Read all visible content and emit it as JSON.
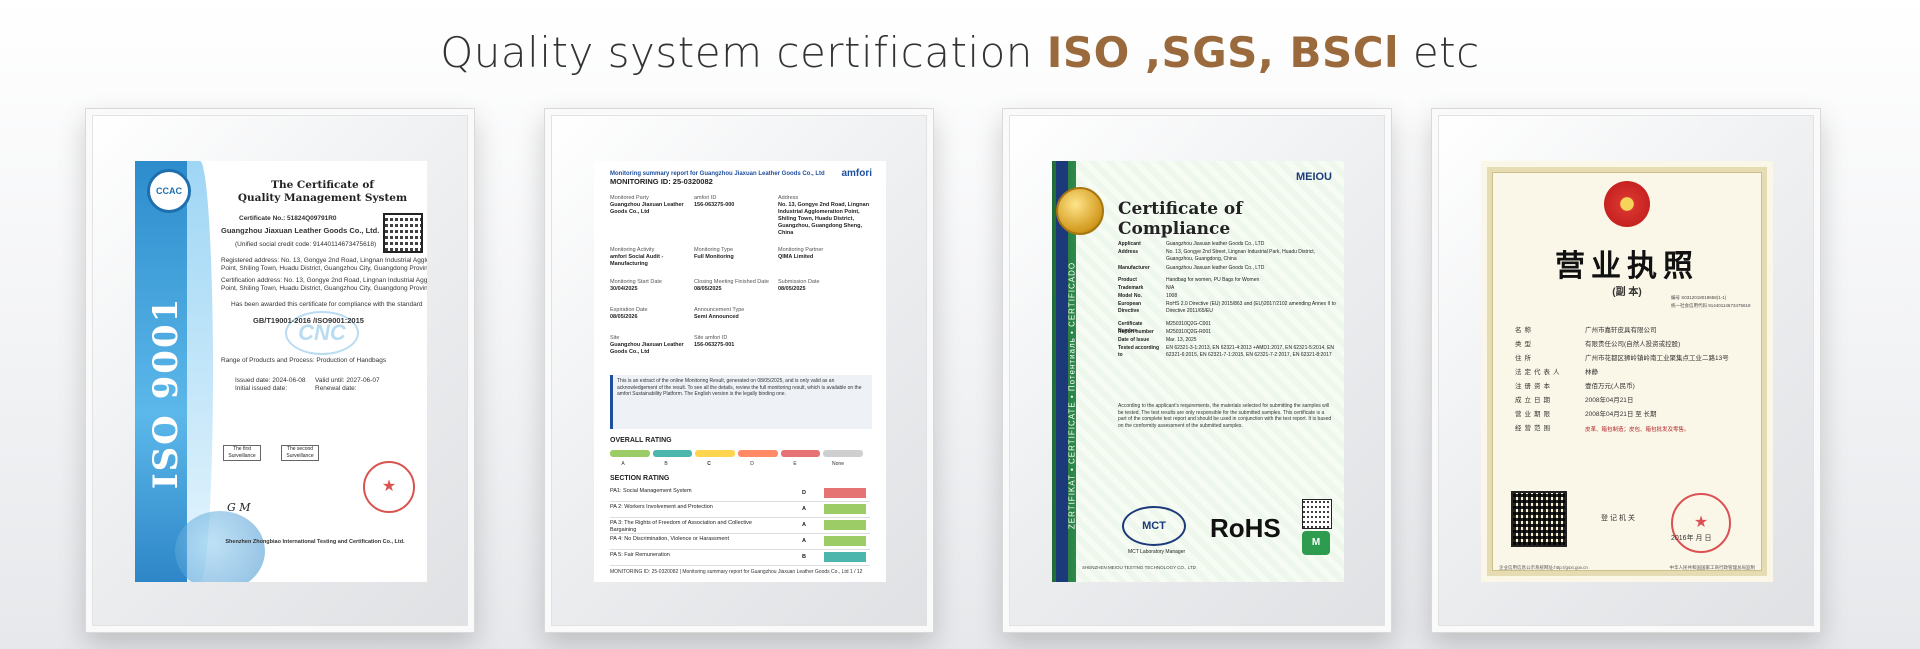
{
  "headline": {
    "prefix": "Quality system certification",
    "brands": "ISO ,SGS, BSCl",
    "suffix": "etc"
  },
  "cert_iso": {
    "vertical": "ISO 9001",
    "title_1": "The Certificate of",
    "title_2": "Quality Management System",
    "cert_no": "Certificate No.: 51824Q09791R0",
    "company": "Guangzhou Jiaxuan Leather Goods Co., Ltd.",
    "credit_code": "(Unified social credit code: 91440114673475618)",
    "reg_address_1": "Registered address: No. 13, Gongye 2nd Road, Lingnan Industrial Agglomeration",
    "reg_address_2": "Point, Shiling Town, Huadu District, Guangzhou City, Guangdong Province, China",
    "cert_address_1": "Certification address: No. 13, Gongye 2nd Road, Lingnan Industrial Agglomeration",
    "cert_address_2": "Point, Shiling Town, Huadu District, Guangzhou City, Guangdong Province, China",
    "awarded": "Has been awarded this certificate for compliance with the standard",
    "standard": "GB/T19001-2016 /ISO9001:2015",
    "range": "Range of Products and Process: Production of Handbags",
    "issued": "Issued date: 2024-06-08",
    "valid": "Valid until: 2027-06-07",
    "initial": "Initial issued date:",
    "renewal": "Renewal date:",
    "box_1": "The first Surveillance",
    "box_2": "The second Surveillance",
    "signature": "G M",
    "logo": "CNC",
    "footer_org": "Shenzhen Zhongbiao International Testing and Certification Co., Ltd."
  },
  "cert_amfori": {
    "report_title": "Monitoring summary report for Guangzhou Jiaxuan Leather Goods Co., Ltd",
    "monitoring_id": "MONITORING ID: 25-0320082",
    "brand": "amfori",
    "fields": [
      {
        "k": "Monitored Party",
        "v": "Guangzhou Jiaxuan Leather Goods Co., Ltd"
      },
      {
        "k": "amfori ID",
        "v": "156-063275-000"
      },
      {
        "k": "Address",
        "v": "No. 13, Gongye 2nd Road, Lingnan Industrial Agglomeration Point, Shiling Town, Huadu District, Guangzhou, Guangdong Sheng, China"
      },
      {
        "k": "Monitoring Activity",
        "v": "amfori Social Audit - Manufacturing"
      },
      {
        "k": "Monitoring Type",
        "v": "Full Monitoring"
      },
      {
        "k": "Monitoring Partner",
        "v": "QIMA Limited"
      },
      {
        "k": "Monitoring Start Date",
        "v": "30/04/2025"
      },
      {
        "k": "Closing Meeting Finished Date",
        "v": "08/05/2025"
      },
      {
        "k": "Submission Date",
        "v": "08/05/2025"
      },
      {
        "k": "Expiration Date",
        "v": "08/05/2026"
      },
      {
        "k": "Announcement Type",
        "v": "Semi Announced"
      },
      {
        "k": "Site",
        "v": "Guangzhou Jiaxuan Leather Goods Co., Ltd"
      },
      {
        "k": "Site amfori ID",
        "v": "156-063275-001"
      }
    ],
    "notice": "This is an extract of the online Monitoring Result, generated on 08/05/2025, and is only valid as an acknowledgement of the result. To see all the details, review the full monitoring result, which is available on the amfori Sustainability Platform. The English version is the legally binding one.",
    "overall_heading": "OVERALL RATING",
    "scale": [
      "A",
      "B",
      "C",
      "D",
      "E",
      "None"
    ],
    "scale_colors": [
      "#9ccc65",
      "#4db6ac",
      "#ffd54f",
      "#ff8a65",
      "#e57373",
      "#cfcfcf"
    ],
    "section_heading": "SECTION RATING",
    "sections": [
      {
        "label": "PA1: Social Management System",
        "grade": "D",
        "color": "#e57373"
      },
      {
        "label": "PA 2: Workers Involvement and Protection",
        "grade": "A",
        "color": "#9ccc65"
      },
      {
        "label": "PA 3: The Rights of Freedom of Association and Collective Bargaining",
        "grade": "A",
        "color": "#9ccc65"
      },
      {
        "label": "PA 4: No Discrimination, Violence or Harassment",
        "grade": "A",
        "color": "#9ccc65"
      },
      {
        "label": "PA 5: Fair Remuneration",
        "grade": "B",
        "color": "#4db6ac"
      }
    ],
    "footer": "MONITORING ID: 25-0320082 | Monitoring summary report for Guangzhou Jiaxuan Leather Goods Co., Ltd 1 / 12"
  },
  "cert_rohs": {
    "brand": "MEIOU",
    "title": "Certificate of Compliance",
    "vertical": "ZERTIFIKAT • CERTIFICATE • Потентиаль • CERTIFICADO",
    "fields": [
      {
        "k": "Applicant",
        "v": "Guangzhou Jiaxuan leather Goods Co., LTD"
      },
      {
        "k": "Address",
        "v": "No. 13, Gongye 2nd Street, Lingnan Industrial Park, Huadu District, Guangzhou, Guangdong, China"
      },
      {
        "k": "Manufacturer",
        "v": "Guangzhou Jiaxuan leather Goods Co., LTD"
      },
      {
        "k": "Product",
        "v": "Handbag for women, PU Bags for Women"
      },
      {
        "k": "Trademark",
        "v": "N/A"
      },
      {
        "k": "Model No.",
        "v": "1008"
      },
      {
        "k": "European Directive",
        "v": "RoHS 2.0 Directive (EU) 2015/863 and (EU)2017/2102 amending Annex II to Directive 2011/65/EU"
      },
      {
        "k": "Certificate Number",
        "v": "M250310Q2G-C001"
      },
      {
        "k": "Report number",
        "v": "M250310Q2G-R001"
      },
      {
        "k": "Date of Issue",
        "v": "Mar. 13, 2025"
      },
      {
        "k": "Tested according to",
        "v": "EN 62321-3-1:2013, EN 62321-4:2013 +AMD1:2017, EN 62321-5:2014, EN 62321-6:2015, EN 62321-7-1:2015, EN 62321-7-2:2017, EN 62321-8:2017"
      }
    ],
    "paragraph": "According to the applicant's requirements, the materials selected for submitting the samples will be tested. The test results are only responsible for the submitted samples. This certificate is a part of the complete test report and should be used in conjunction with the test report. It is based on the conformity assessment of the submitted samples.",
    "logo": "MCT",
    "rohs": "RoHS",
    "manager": "MCT Laboratory Manager",
    "footer_org": "SHENZHEN MEIOU TESTING TECHNOLOGY CO., LTD"
  },
  "cert_license": {
    "title": "营业执照",
    "copy": "(副 本)",
    "serial": "编号 S0312018019658(1-1)",
    "credit": "统一社会信用代码 91440114673475618",
    "fields": [
      {
        "k": "名称",
        "v": "广州市嘉轩皮具有限公司"
      },
      {
        "k": "类型",
        "v": "有限责任公司(自然人投资或控股)"
      },
      {
        "k": "住所",
        "v": "广州市花都区狮岭镇岭南工业聚集点工业二路13号"
      },
      {
        "k": "法定代表人",
        "v": "林静"
      },
      {
        "k": "注册资本",
        "v": "壹佰万元(人民币)"
      },
      {
        "k": "成立日期",
        "v": "2008年04月21日"
      },
      {
        "k": "营业期限",
        "v": "2008年04月21日 至 长期"
      },
      {
        "k": "经营范围",
        "v": ""
      }
    ],
    "scope": "皮革、箱包制造；皮包、箱包批发及零售。",
    "registrar": "登记机关",
    "issue_date": "2016年  月  日",
    "footer_left": "企业信用信息公示系统网址:http://gsxt.gov.cn",
    "footer_right": "中华人民共和国国家工商行政管理总局监制"
  }
}
